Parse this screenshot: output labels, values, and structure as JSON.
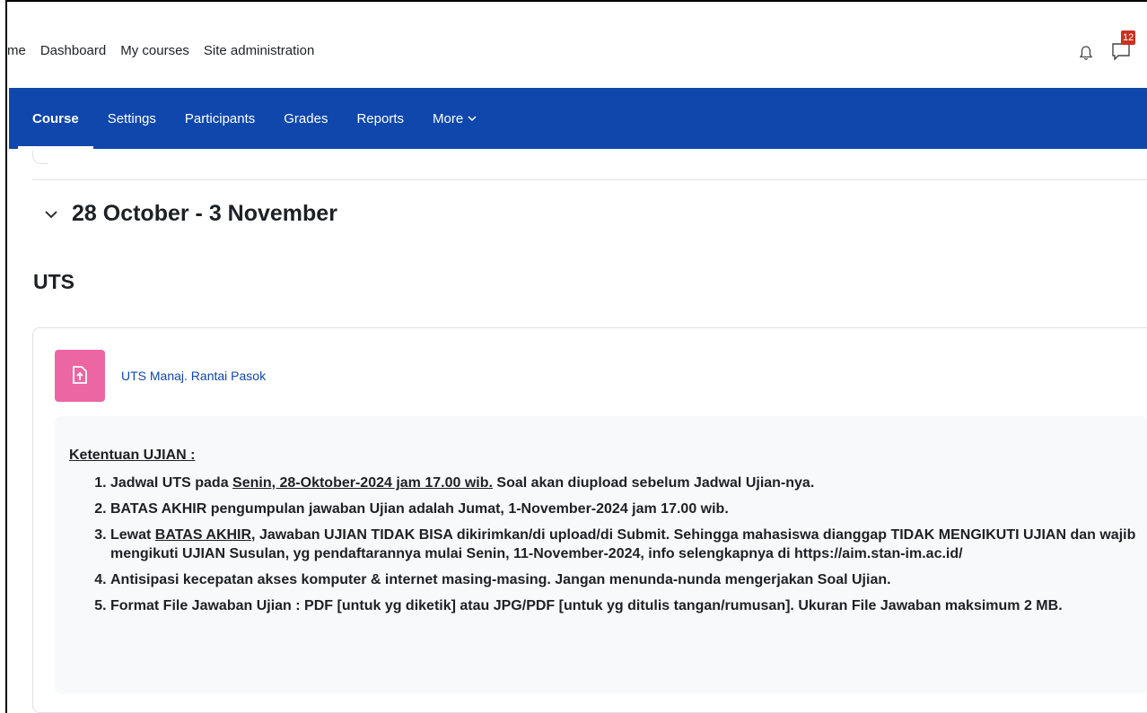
{
  "topnav": {
    "items": [
      "me",
      "Dashboard",
      "My courses",
      "Site administration"
    ],
    "notification_count": "12"
  },
  "secondary_nav": {
    "tabs": [
      "Course",
      "Settings",
      "Participants",
      "Grades",
      "Reports",
      "More"
    ]
  },
  "section": {
    "title": "28 October - 3 November",
    "subtitle": "UTS"
  },
  "activity": {
    "name": "UTS Manaj. Rantai Pasok"
  },
  "description": {
    "heading": "Ketentuan UJIAN :",
    "item1": {
      "pre": "Jadwal UTS pada ",
      "underlined": "Senin, 28-Oktober-2024 jam 17.00 wib.",
      "post": " Soal akan diupload sebelum Jadwal Ujian-nya."
    },
    "item2": "BATAS AKHIR pengumpulan jawaban Ujian adalah Jumat, 1-November-2024 jam 17.00 wib.",
    "item3": {
      "pre": "Lewat ",
      "underlined": "BATAS AKHIR",
      "post": ", Jawaban UJIAN TIDAK BISA dikirimkan/di upload/di Submit. Sehingga mahasiswa dianggap TIDAK MENGIKUTI UJIAN dan wajib mengikuti UJIAN Susulan, yg pendaftarannya mulai Senin, 11-November-2024, info selengkapnya di https://aim.stan-im.ac.id/"
    },
    "item4": "Antisipasi kecepatan akses komputer & internet masing-masing. Jangan menunda-nunda mengerjakan Soal Ujian.",
    "item5": "Format File Jawaban Ujian : PDF [untuk yg diketik] atau JPG/PDF [untuk yg ditulis tangan/rumusan]. Ukuran File Jawaban maksimum 2 MB."
  },
  "colors": {
    "brand": "#0f47ad",
    "activity_icon": "#eb66a2",
    "badge": "#ca3120"
  }
}
